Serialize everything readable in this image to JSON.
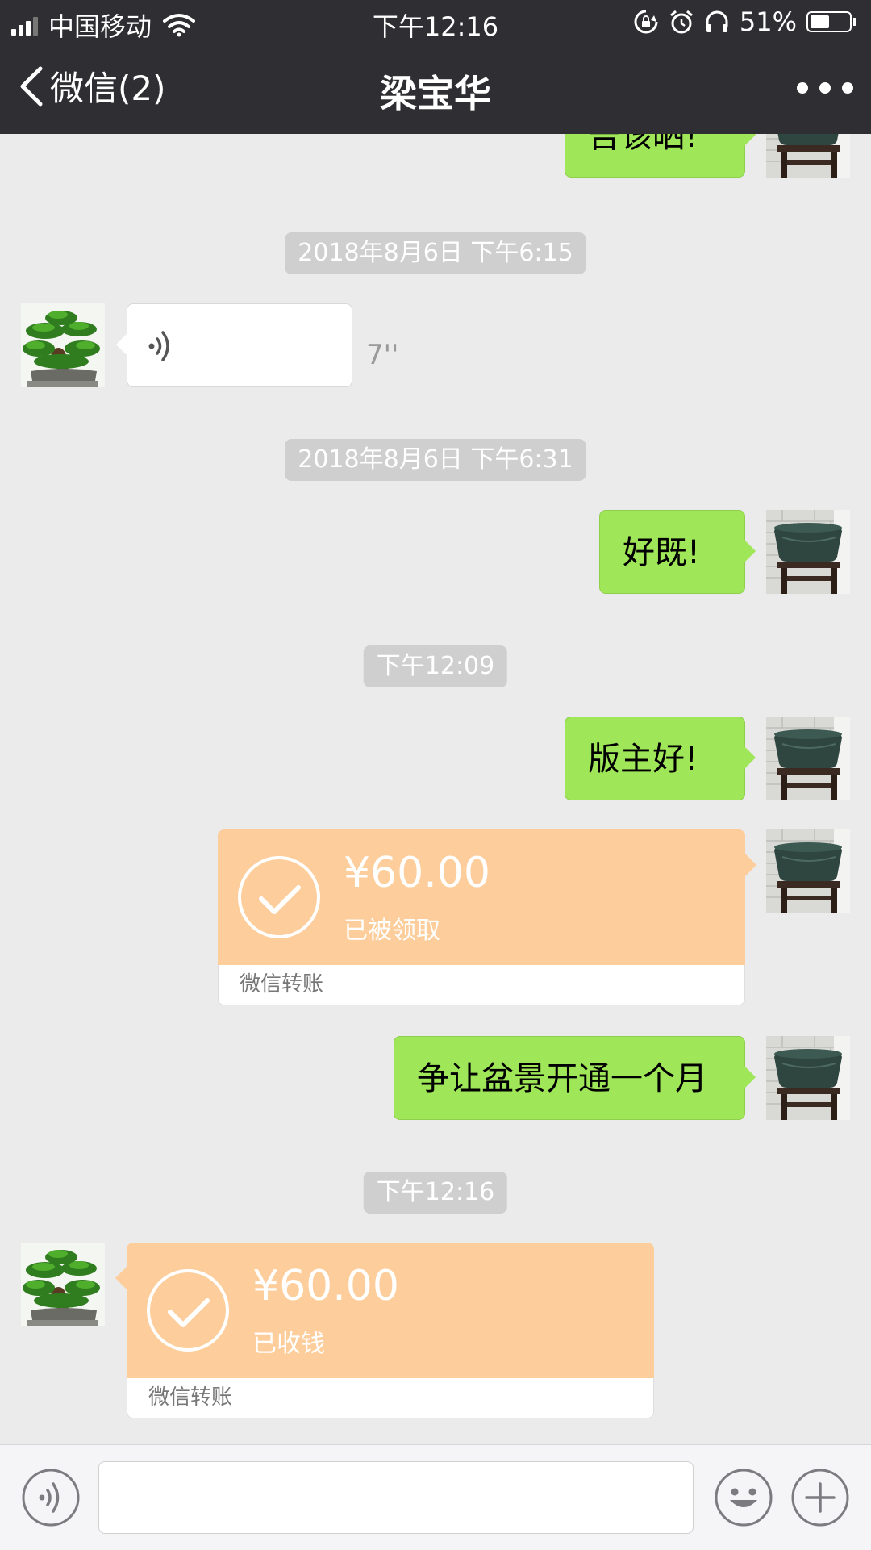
{
  "status_bar": {
    "carrier": "中国移动",
    "time": "下午12:16",
    "battery_percent": "51%",
    "battery_level": 0.51
  },
  "nav": {
    "back_label": "微信(2)",
    "title": "梁宝华"
  },
  "messages": {
    "partial_top": "告该晒!",
    "ts1": "2018年8月6日 下午6:15",
    "voice_duration": "7''",
    "ts2": "2018年8月6日 下午6:31",
    "msg_good": "好既!",
    "ts3": "下午12:09",
    "msg_hello": "版主好!",
    "transfer1": {
      "amount": "¥60.00",
      "status": "已被领取",
      "footer": "微信转账"
    },
    "msg_renew": "争让盆景开通一个月",
    "ts4": "下午12:16",
    "transfer2": {
      "amount": "¥60.00",
      "status": "已收钱",
      "footer": "微信转账"
    }
  },
  "input_bar": {
    "placeholder": ""
  },
  "icons": {
    "back": "chevron-left-icon",
    "more": "more-icon",
    "voice": "voice-icon",
    "emoji": "emoji-icon",
    "add": "plus-icon",
    "check": "check-circle-icon"
  },
  "colors": {
    "nav_bg": "#2f2f33",
    "chat_bg": "#ebebeb",
    "green_bubble": "#9fe658",
    "transfer_bg": "#fdce9c"
  }
}
